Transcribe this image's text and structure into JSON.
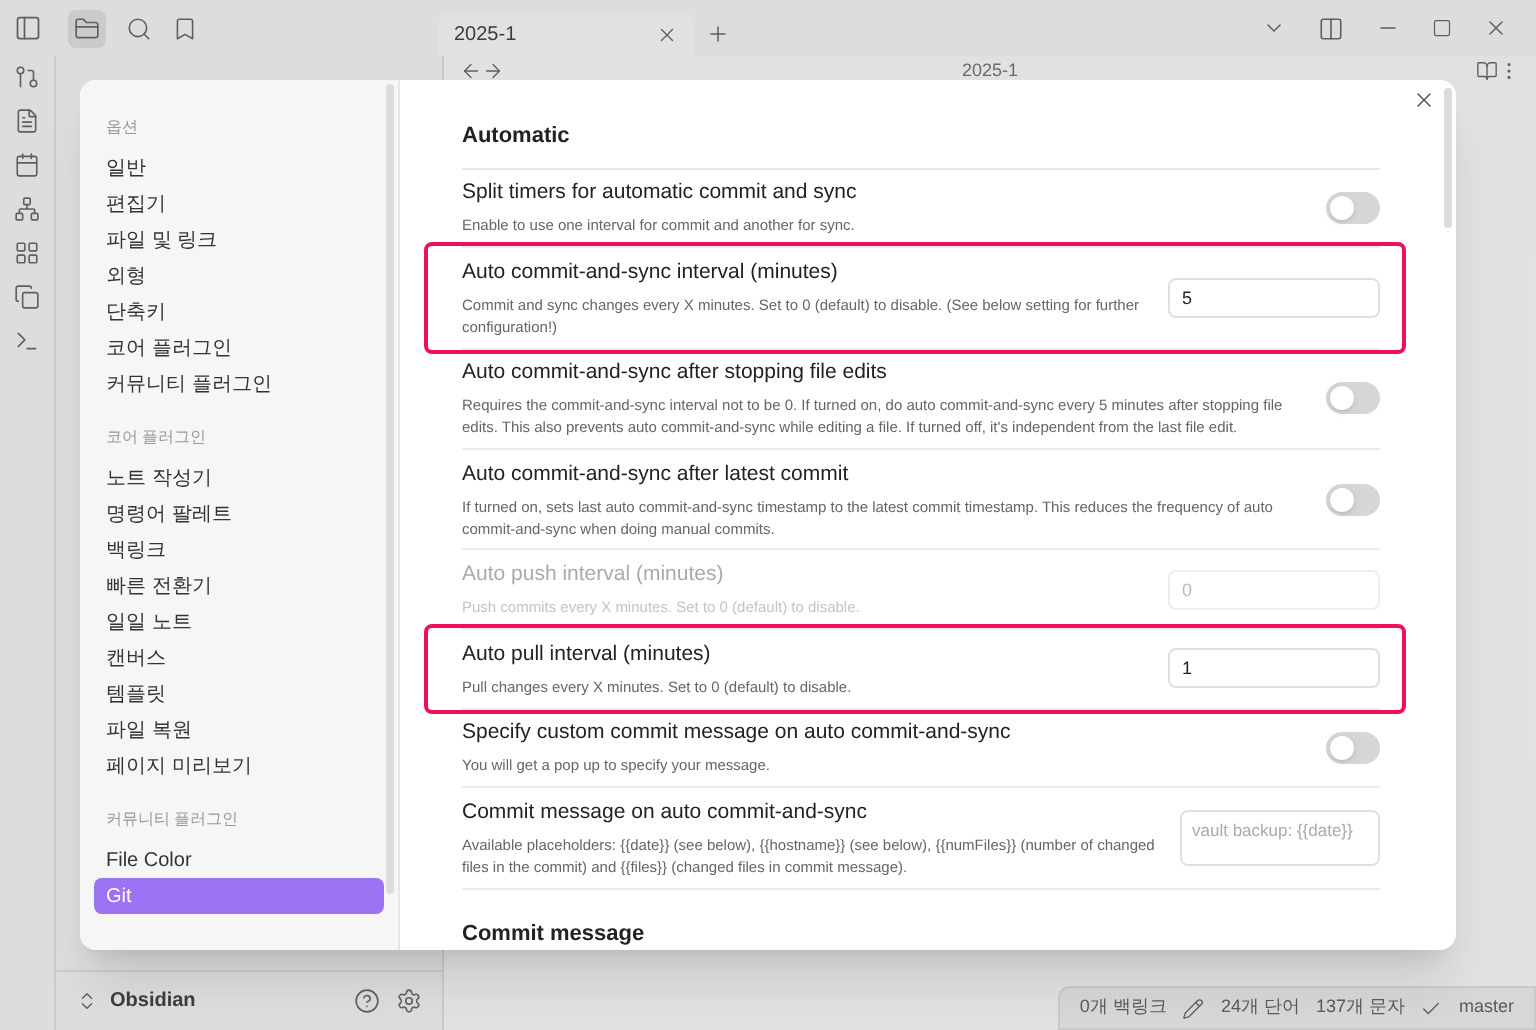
{
  "tab": {
    "title": "2025-1",
    "selected": true
  },
  "view_title": "2025-1",
  "vault": {
    "name": "Obsidian"
  },
  "status_bar": [
    "0개 백링크",
    "24개 단어",
    "137개 문자",
    "master"
  ],
  "settings_nav": [
    {
      "heading": "옵션",
      "items": [
        {
          "label": "일반",
          "selected": false
        },
        {
          "label": "편집기",
          "selected": false
        },
        {
          "label": "파일 및 링크",
          "selected": false
        },
        {
          "label": "외형",
          "selected": false
        },
        {
          "label": "단축키",
          "selected": false
        },
        {
          "label": "코어 플러그인",
          "selected": false
        },
        {
          "label": "커뮤니티 플러그인",
          "selected": false
        }
      ]
    },
    {
      "heading": "코어 플러그인",
      "items": [
        {
          "label": "노트 작성기",
          "selected": false
        },
        {
          "label": "명령어 팔레트",
          "selected": false
        },
        {
          "label": "백링크",
          "selected": false
        },
        {
          "label": "빠른 전환기",
          "selected": false
        },
        {
          "label": "일일 노트",
          "selected": false
        },
        {
          "label": "캔버스",
          "selected": false
        },
        {
          "label": "템플릿",
          "selected": false
        },
        {
          "label": "파일 복원",
          "selected": false
        },
        {
          "label": "페이지 미리보기",
          "selected": false
        }
      ]
    },
    {
      "heading": "커뮤니티 플러그인",
      "items": [
        {
          "label": "File Color",
          "selected": false
        },
        {
          "label": "Git",
          "selected": true
        }
      ]
    }
  ],
  "section_title": "Automatic",
  "settings": [
    {
      "kind": "toggle",
      "name": "Split timers for automatic commit and sync",
      "desc": "Enable to use one interval for commit and another for sync.",
      "on": false,
      "highlighted": false,
      "disabled": false
    },
    {
      "kind": "text",
      "name": "Auto commit-and-sync interval (minutes)",
      "desc": "Commit and sync changes every X minutes. Set to 0 (default) to disable. (See below setting for further configuration!)",
      "value": "5",
      "highlighted": true,
      "disabled": false
    },
    {
      "kind": "toggle",
      "name": "Auto commit-and-sync after stopping file edits",
      "desc": "Requires the commit-and-sync interval not to be 0. If turned on, do auto commit-and-sync every 5 minutes after stopping file edits. This also prevents auto commit-and-sync while editing a file. If turned off, it's independent from the last file edit.",
      "on": false,
      "highlighted": false,
      "disabled": false
    },
    {
      "kind": "toggle",
      "name": "Auto commit-and-sync after latest commit",
      "desc": "If turned on, sets last auto commit-and-sync timestamp to the latest commit timestamp. This reduces the frequency of auto commit-and-sync when doing manual commits.",
      "on": false,
      "highlighted": false,
      "disabled": false
    },
    {
      "kind": "text",
      "name": "Auto push interval (minutes)",
      "desc": "Push commits every X minutes. Set to 0 (default) to disable.",
      "value": "0",
      "highlighted": false,
      "disabled": true
    },
    {
      "kind": "text",
      "name": "Auto pull interval (minutes)",
      "desc": "Pull changes every X minutes. Set to 0 (default) to disable.",
      "value": "1",
      "highlighted": true,
      "disabled": false
    },
    {
      "kind": "toggle",
      "name": "Specify custom commit message on auto commit-and-sync",
      "desc": "You will get a pop up to specify your message.",
      "on": false,
      "highlighted": false,
      "disabled": false
    },
    {
      "kind": "textarea",
      "name": "Commit message on auto commit-and-sync",
      "desc": "Available placeholders: {{date}} (see below), {{hostname}} (see below), {{numFiles}} (number of changed files in the commit) and {{files}} (changed files in commit message).",
      "placeholder": "vault backup: {{date}}",
      "highlighted": false,
      "disabled": false
    }
  ],
  "next_section_title": "Commit message"
}
